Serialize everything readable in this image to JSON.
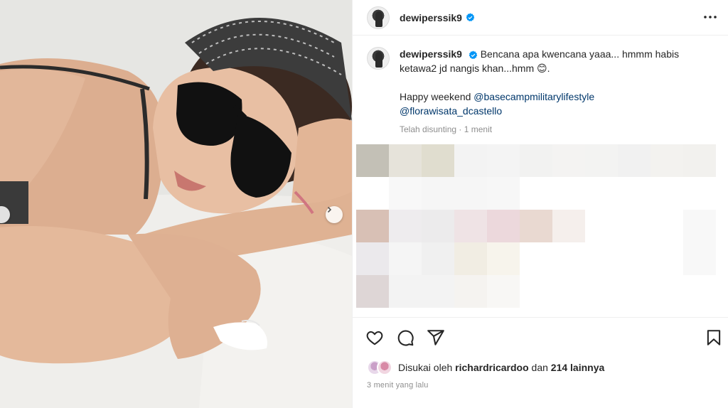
{
  "post": {
    "username": "dewiperssik9",
    "caption_username": "dewiperssik9",
    "caption_text": "Bencana apa kwencana yaaa... hmmm habis ketawa2 jd nangis khan...hmm",
    "caption_emoji": "😊",
    "caption_after_emoji": ".",
    "caption_line2_prefix": "Happy weekend",
    "mention_1": "@basecampmilitarylifestyle",
    "mention_2": "@florawisata_dcastello",
    "edited_label": "Telah disunting",
    "separator": "·",
    "edited_time": "1 menit"
  },
  "engagement": {
    "liked_by_prefix": "Disukai oleh",
    "liked_by_user": "richardricardoo",
    "and_label": "dan",
    "others_count": "214 lainnya",
    "time_ago": "3 menit yang lalu"
  },
  "icons": {
    "like": "heart-icon",
    "comment": "comment-icon",
    "share": "share-icon",
    "save": "bookmark-icon",
    "more": "more-options-icon",
    "verified": "verified-badge-icon",
    "next": "chevron-right-icon"
  },
  "colors": {
    "verified_blue": "#0095f6",
    "link": "#00376b",
    "muted": "#8e8e8e",
    "text": "#262626"
  }
}
